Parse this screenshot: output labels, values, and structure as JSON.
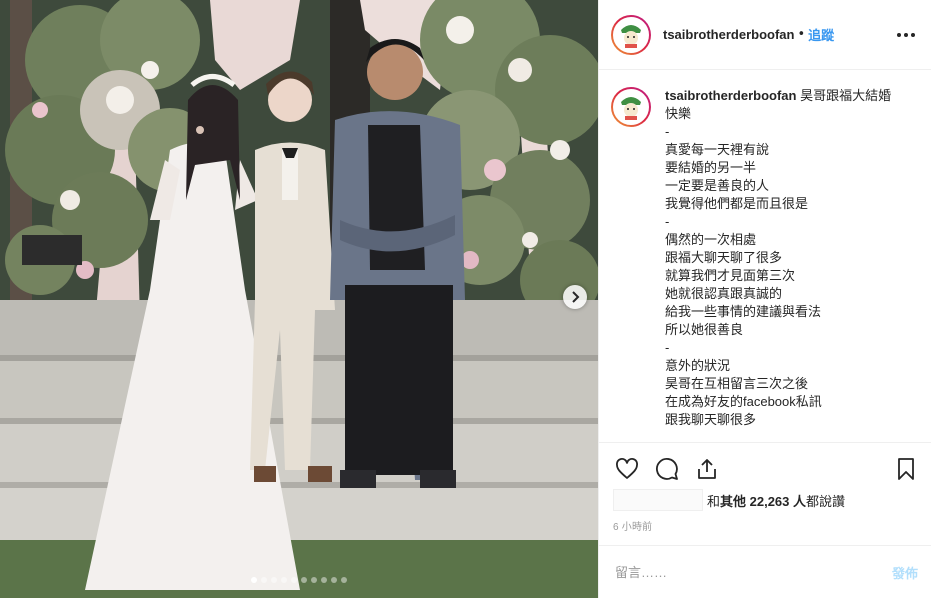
{
  "post": {
    "username": "tsaibrotherderboofan",
    "follow_label": "追蹤",
    "separator": "•",
    "photo_alt": "三人在婚禮花牆前合影",
    "carousel": {
      "total_slides": 10,
      "active_index": 0
    }
  },
  "caption": {
    "username": "tsaibrotherderboofan",
    "text": " 昊哥跟福大結婚\n快樂\n-\n真愛每一天裡有說\n要結婚的另一半\n一定要是善良的人\n我覺得他們都是而且很是\n-\n偶然的一次相處\n跟福大聊天聊了很多\n就算我們才見面第三次\n她就很認真跟真誠的\n給我一些事情的建議與看法\n所以她很善良\n-\n意外的狀況\n昊哥在互相留言三次之後\n在成為好友的facebook私訊\n跟我聊天聊很多"
  },
  "likes": {
    "prefix": "和 ",
    "others_label": "其他 22,263 人",
    "suffix": " 都說讚"
  },
  "timestamp": "6 小時前",
  "comment": {
    "placeholder": "留言……",
    "post_label": "發佈"
  },
  "icons": {
    "like": "heart-icon",
    "comment": "comment-bubble-icon",
    "share": "share-icon",
    "save": "bookmark-icon",
    "more": "more-options-icon",
    "next": "chevron-right-icon"
  },
  "colors": {
    "follow": "#3897f0",
    "post_disabled": "#b2dffc",
    "muted": "#999999",
    "text": "#262626"
  }
}
